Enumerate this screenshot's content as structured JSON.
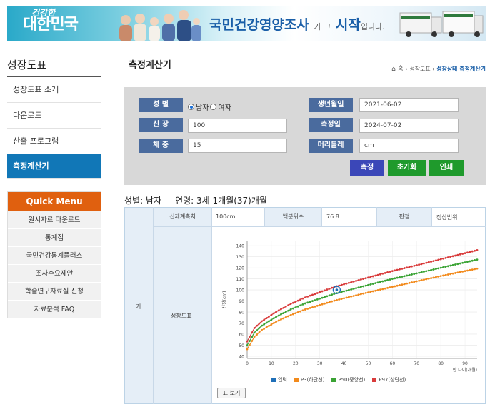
{
  "banner": {
    "logo_top": "건강한",
    "logo_bottom": "대한민국",
    "title": "국민건강영양조사",
    "title_mid": "가 그",
    "title_big": "시작",
    "title_end": "입니다."
  },
  "sidebar": {
    "title": "성장도표",
    "items": [
      "성장도표 소개",
      "다운로드",
      "산출 프로그램",
      "측정계산기"
    ],
    "quick_title": "Quick Menu",
    "quick_items": [
      "원시자료 다운로드",
      "통계집",
      "국민건강통계플러스",
      "조사수요제안",
      "학술연구자료실 신청",
      "자료분석 FAQ"
    ]
  },
  "page": {
    "title": "측정계산기",
    "breadcrumb_home": "⌂ 홈",
    "breadcrumb_1": "성장도표",
    "breadcrumb_2": "성장상태 측정계산기"
  },
  "form": {
    "sex_label": "성 별",
    "sex_options": [
      "남자",
      "여자"
    ],
    "sex_selected": "남자",
    "height_label": "신 장",
    "height_value": "100",
    "weight_label": "체 중",
    "weight_value": "15",
    "birth_label": "생년월일",
    "birth_value": "2021-06-02",
    "measure_label": "측정일",
    "measure_value": "2024-07-02",
    "head_label": "머리둘레",
    "head_value": "cm",
    "btn_measure": "측정",
    "btn_reset": "초기화",
    "btn_print": "인쇄"
  },
  "result": {
    "summary": "성별: 남자     연령: 3세 1개월(37)개월",
    "row_label": "키",
    "col_measure": "신체계측치",
    "val_measure": "100cm",
    "col_percentile": "백분위수",
    "val_percentile": "76.8",
    "col_judge": "판정",
    "val_judge": "정상범위",
    "chart_label": "성장도표",
    "table_button": "표 보기"
  },
  "colors": {
    "accent": "#1177b7",
    "quick": "#e0600f",
    "label_bg": "#4a6b9e",
    "btn_measure": "#3b47b8",
    "btn_green": "#1f9a2c",
    "p3": "#f28a1c",
    "p50": "#3aa334",
    "p97": "#d93b3b",
    "input": "#1f6fb8"
  },
  "chart_data": {
    "type": "line",
    "xlabel": "만 나이(개월)",
    "ylabel": "신장(cm)",
    "xlim": [
      0,
      95
    ],
    "ylim": [
      38,
      144
    ],
    "x_ticks": [
      0,
      10,
      20,
      30,
      40,
      50,
      60,
      70,
      80,
      90
    ],
    "y_ticks": [
      40,
      50,
      60,
      70,
      80,
      90,
      100,
      110,
      120,
      130,
      140
    ],
    "grid": true,
    "legend": "bottom",
    "legend_labels": [
      "입력",
      "P3(하단선)",
      "P50(중앙선)",
      "P97(상단선)"
    ],
    "series": [
      {
        "name": "P3(하단선)",
        "x": [
          0,
          3,
          6,
          12,
          18,
          24,
          36,
          48,
          60,
          72,
          84,
          95
        ],
        "y": [
          46.3,
          57.6,
          63.6,
          71.3,
          77.2,
          82.3,
          90.3,
          96.7,
          102.8,
          108.8,
          114.4,
          119.3
        ]
      },
      {
        "name": "P50(중앙선)",
        "x": [
          0,
          3,
          6,
          12,
          18,
          24,
          36,
          48,
          60,
          72,
          84,
          95
        ],
        "y": [
          49.9,
          61.4,
          67.6,
          75.7,
          82.3,
          87.8,
          96.5,
          103.3,
          110.0,
          116.0,
          122.0,
          127.4
        ]
      },
      {
        "name": "P97(상단선)",
        "x": [
          0,
          3,
          6,
          12,
          18,
          24,
          36,
          48,
          60,
          72,
          84,
          95
        ],
        "y": [
          53.4,
          65.5,
          71.6,
          80.2,
          87.3,
          93.2,
          102.7,
          110.0,
          117.1,
          123.4,
          130.0,
          136.0
        ]
      }
    ],
    "input_point": {
      "x": 37,
      "y": 100
    }
  }
}
